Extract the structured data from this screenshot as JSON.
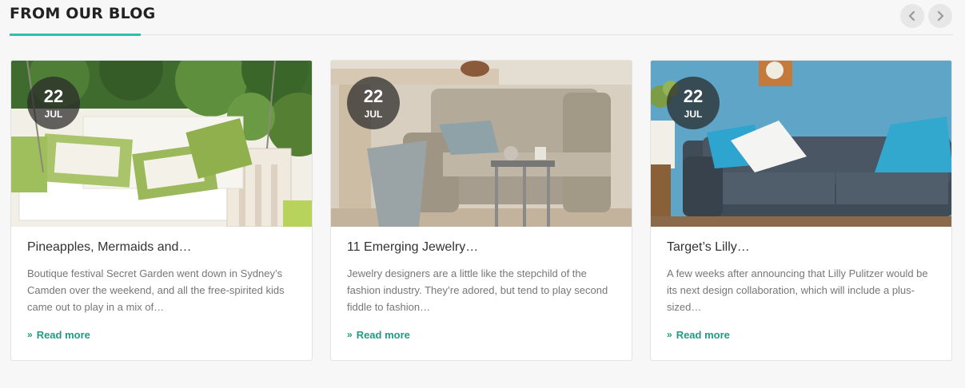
{
  "section": {
    "title": "FROM OUR BLOG",
    "accent_color": "#2ec0a8",
    "prev_icon": "chevron-left-icon",
    "next_icon": "chevron-right-icon"
  },
  "posts": [
    {
      "day": "22",
      "month": "JUL",
      "title": "Pineapples, Mermaids and…",
      "excerpt": "Boutique festival Secret Garden went down in Sydney’s Camden over the weekend, and all the free-spirited kids came out to play in a mix of…",
      "read_more": "Read more",
      "image": "porch swing with green and white cushions"
    },
    {
      "day": "22",
      "month": "JUL",
      "title": "11 Emerging Jewelry…",
      "excerpt": "Jewelry designers are a little like the stepchild of the fashion industry. They’re adored, but tend to play second fiddle to fashion…",
      "read_more": "Read more",
      "image": "beige sofa with side table and throw"
    },
    {
      "day": "22",
      "month": "JUL",
      "title": "Target’s Lilly…",
      "excerpt": "A few weeks after announcing that Lilly Pulitzer would be its next design collaboration, which will include a plus-sized…",
      "read_more": "Read more",
      "image": "dark grey sofa with blue cushions against blue wall"
    }
  ],
  "colors": {
    "link": "#1f9c84",
    "badge_bg": "#282828"
  }
}
